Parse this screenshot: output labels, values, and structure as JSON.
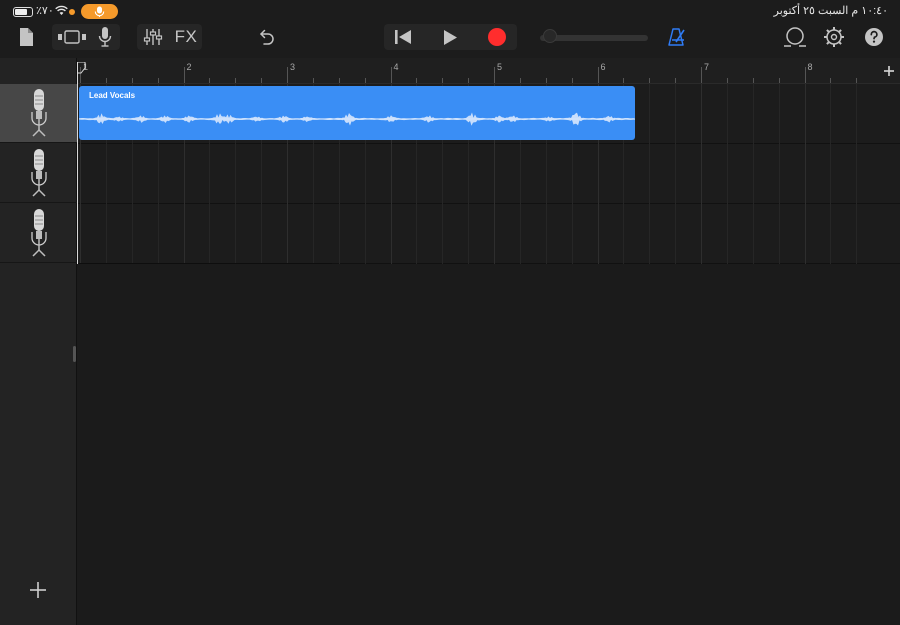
{
  "status_bar": {
    "battery": "٪٧٠",
    "datetime": "١٠:٤٠ م  السبت ٢٥ أكتوبر",
    "mic_indicator_color": "#f59a2b"
  },
  "toolbar": {
    "fx_label": "FX",
    "accent_color": "#2f7cf6",
    "record_color": "#ff2d2d"
  },
  "ruler": {
    "bars": [
      "1",
      "2",
      "3",
      "4",
      "5",
      "6",
      "7",
      "8"
    ]
  },
  "tracks": [
    {
      "instrument_icon": "microphone-icon",
      "selected": true
    },
    {
      "instrument_icon": "microphone-icon",
      "selected": false
    },
    {
      "instrument_icon": "microphone-icon",
      "selected": false
    }
  ],
  "region": {
    "name": "Lead Vocals",
    "color": "#3a8ef5"
  }
}
